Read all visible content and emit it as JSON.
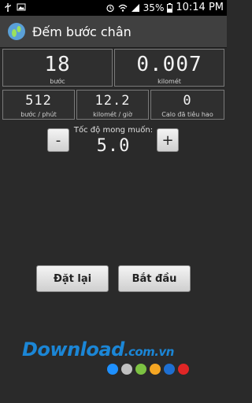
{
  "status_bar": {
    "battery": "35%",
    "time": "10:14 PM",
    "icons": [
      "usb-icon",
      "image-icon",
      "alarm-icon",
      "wifi-icon",
      "signal-icon",
      "battery-icon"
    ]
  },
  "app": {
    "title": "Đếm bước chân",
    "icon": "footprint-icon"
  },
  "stats_top": [
    {
      "value": "18",
      "label": "bước"
    },
    {
      "value": "0.007",
      "label": "kilomét"
    }
  ],
  "stats_mid": [
    {
      "value": "512",
      "label": "bước / phút"
    },
    {
      "value": "12.2",
      "label": "kilomét / giờ"
    },
    {
      "value": "0",
      "label": "Calo đã tiêu hao"
    }
  ],
  "speed": {
    "label": "Tốc độ mong muốn:",
    "value": "5.0",
    "minus_label": "-",
    "plus_label": "+"
  },
  "buttons": {
    "reset_label": "Đặt lại",
    "start_label": "Bắt đầu"
  },
  "watermark": {
    "text": "Download",
    "suffix": ".com.vn",
    "dot_colors": [
      "#1e90ff",
      "#c0c0c0",
      "#7cc242",
      "#f5a623",
      "#1e6fd1",
      "#e02626"
    ]
  }
}
